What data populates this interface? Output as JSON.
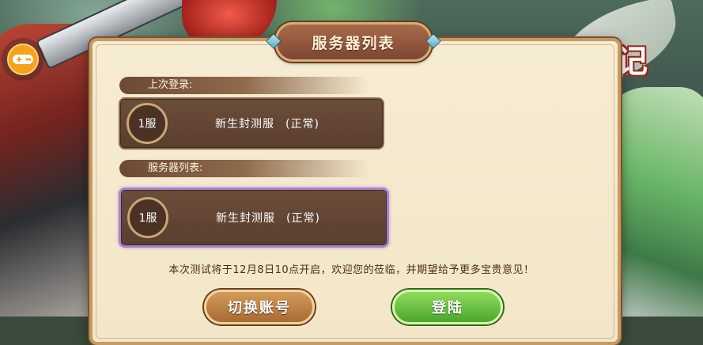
{
  "dialog": {
    "title": "服务器列表",
    "last_login_label": "上次登录:",
    "server_list_label": "服务器列表:",
    "notice": "本次测试将于12月8日10点开启，欢迎您的莅临，并期望给予更多宝贵意见！"
  },
  "last_login_server": {
    "number": "1服",
    "name": "新生封测服",
    "status": "(正常)"
  },
  "server_list": [
    {
      "number": "1服",
      "name": "新生封测服",
      "status": "(正常)",
      "selected": true
    }
  ],
  "buttons": {
    "switch_account": "切换账号",
    "login": "登陆"
  },
  "logo": {
    "title": "战记"
  },
  "colors": {
    "panel": "#f3e6c8",
    "frame": "#c59a63",
    "card": "#5a3e2e",
    "selected_border": "#a882c9",
    "login_green": "#4ca62e",
    "switch_orange": "#a86a34"
  },
  "icons": {
    "float_button": "gamepad-icon",
    "title_ornament": "diamond-gem-icon"
  }
}
